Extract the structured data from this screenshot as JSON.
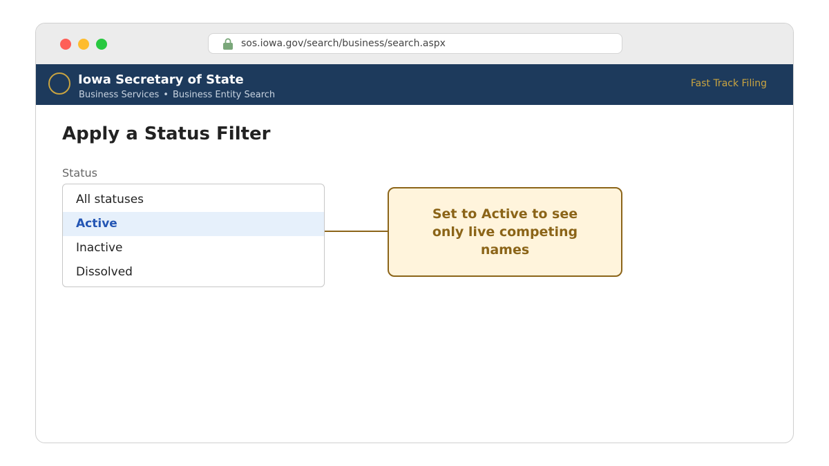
{
  "browser": {
    "url": "sos.iowa.gov/search/business/search.aspx",
    "window_controls": [
      "close-dot",
      "minimize-dot",
      "maximize-dot"
    ],
    "lock_icon": "lock-icon"
  },
  "site_header": {
    "title": "Iowa Secretary of State",
    "breadcrumb": {
      "section": "Business Services",
      "separator": "•",
      "page": "Business Entity Search"
    },
    "link": "Fast Track Filing",
    "colors": {
      "background": "#1d3a5c",
      "accent": "#c9a441"
    }
  },
  "main": {
    "title": "Apply a Status Filter",
    "status_field": {
      "label": "Status",
      "options": [
        "All statuses",
        "Active",
        "Inactive",
        "Dissolved"
      ],
      "selected": "Active"
    }
  },
  "callout": {
    "text": "Set to Active to see only live competing names",
    "colors": {
      "border": "#8b6418",
      "background": "#fff4dc"
    }
  }
}
